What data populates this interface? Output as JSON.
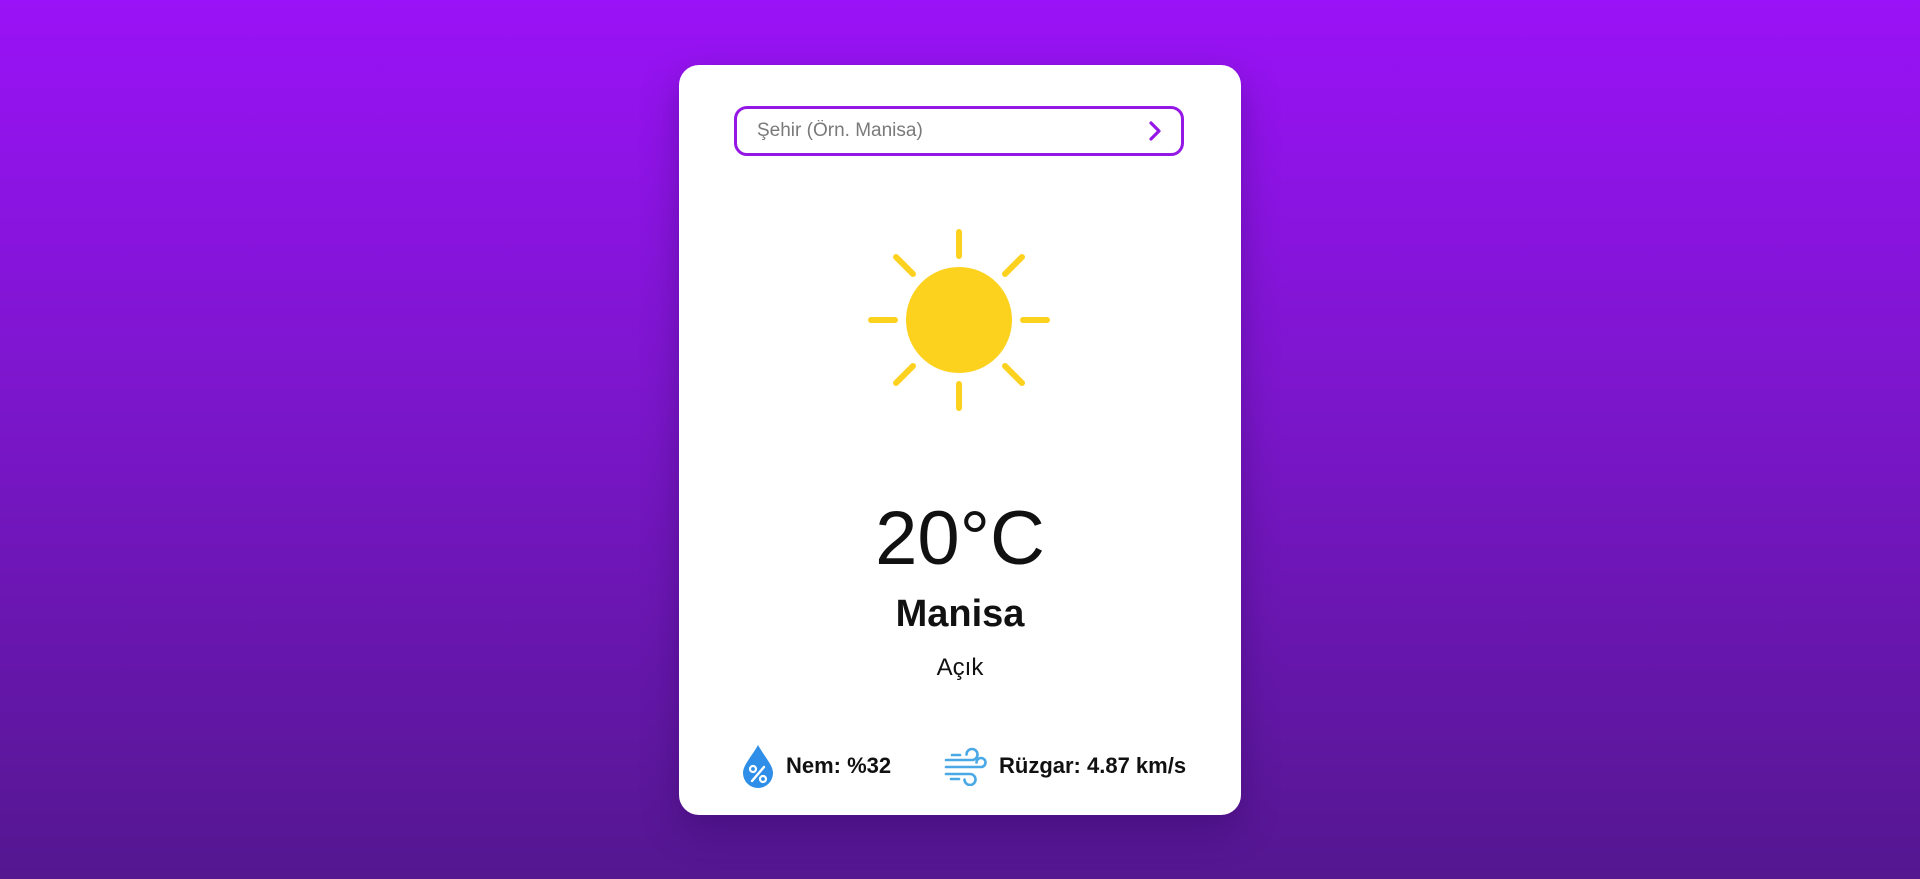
{
  "search": {
    "placeholder": "Şehir (Örn. Manisa)",
    "value": ""
  },
  "weather": {
    "icon": "sun-icon",
    "temperature": "20°C",
    "city": "Manisa",
    "description": "Açık"
  },
  "stats": {
    "humidity": {
      "icon": "humidity-drop-icon",
      "label": "Nem: %32"
    },
    "wind": {
      "icon": "wind-icon",
      "label": "Rüzgar: 4.87 km/s"
    }
  },
  "colors": {
    "accent": "#9517e6",
    "sun": "#fdd21f",
    "humidity_icon": "#2f8fe8",
    "wind_icon": "#4aa8e6",
    "background_top": "#9a12f7",
    "background_bottom": "#541790"
  }
}
